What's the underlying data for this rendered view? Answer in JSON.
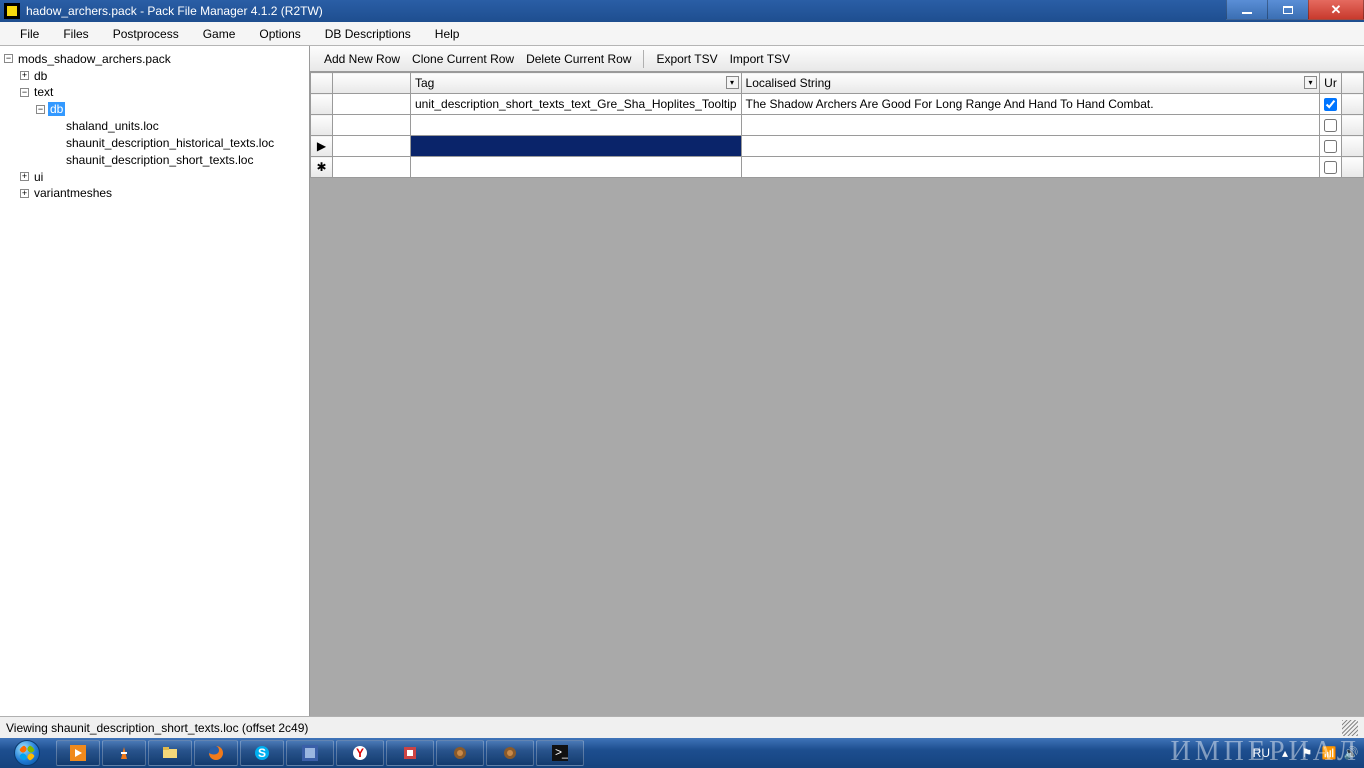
{
  "window": {
    "title": "hadow_archers.pack - Pack File Manager 4.1.2 (R2TW)"
  },
  "menubar": [
    "File",
    "Files",
    "Postprocess",
    "Game",
    "Options",
    "DB Descriptions",
    "Help"
  ],
  "tree": {
    "root": "mods_shadow_archers.pack",
    "db": "db",
    "text": "text",
    "text_db": "db",
    "files": [
      "shaland_units.loc",
      "shaunit_description_historical_texts.loc",
      "shaunit_description_short_texts.loc"
    ],
    "ui": "ui",
    "variantmeshes": "variantmeshes"
  },
  "toolbar": {
    "add": "Add New Row",
    "clone": "Clone Current Row",
    "delete": "Delete Current Row",
    "export": "Export TSV",
    "import": "Import TSV"
  },
  "grid": {
    "col_tag": "Tag",
    "col_loc": "Localised String",
    "col_ur": "Ur",
    "rows": [
      {
        "tag": "unit_description_short_texts_text_Gre_Sha_Hoplites_Tooltip",
        "loc": "The Shadow Archers Are Good For Long Range And Hand To Hand Combat.",
        "ur": true
      },
      {
        "tag": "",
        "loc": "",
        "ur": false
      },
      {
        "tag": "",
        "loc": "",
        "ur": false
      }
    ]
  },
  "statusbar": {
    "text": "Viewing shaunit_description_short_texts.loc (offset 2c49)"
  },
  "taskbar": {
    "lang": "RU",
    "watermark": "ИМПЕРИАЛ"
  }
}
